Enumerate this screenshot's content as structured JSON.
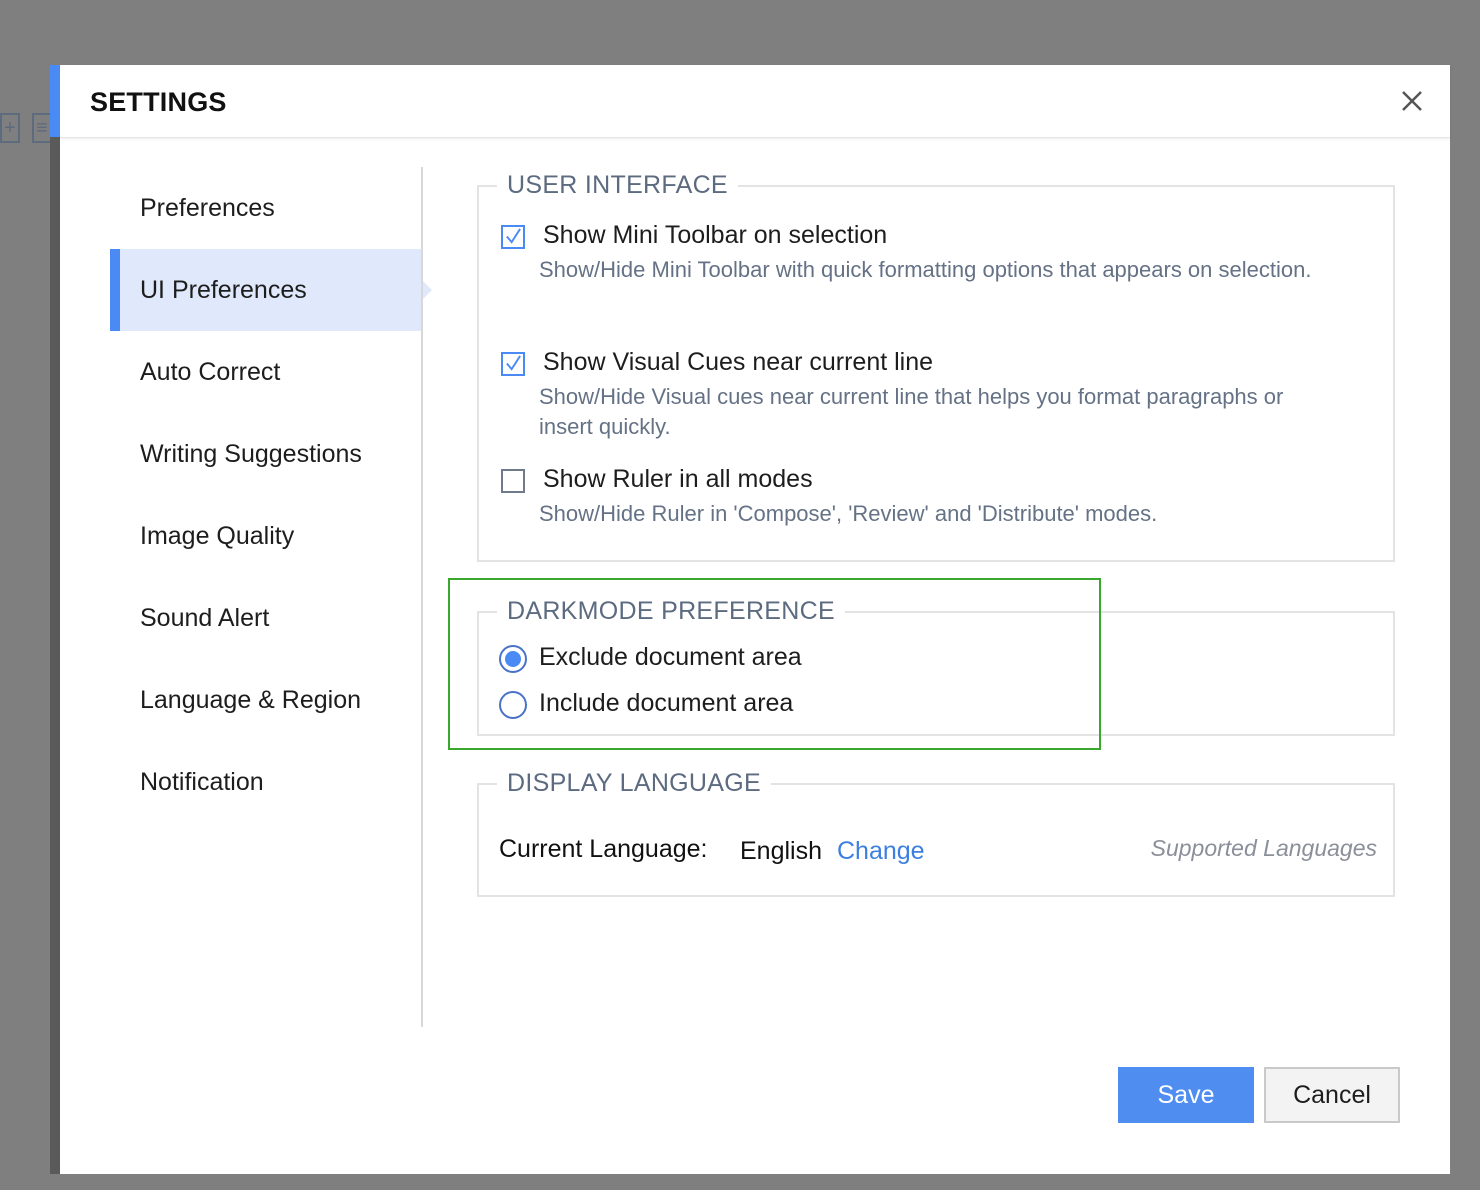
{
  "dialog": {
    "title": "SETTINGS"
  },
  "sidebar": {
    "items": [
      {
        "label": "Preferences",
        "active": false
      },
      {
        "label": "UI Preferences",
        "active": true
      },
      {
        "label": "Auto Correct",
        "active": false
      },
      {
        "label": "Writing Suggestions",
        "active": false
      },
      {
        "label": "Image Quality",
        "active": false
      },
      {
        "label": "Sound Alert",
        "active": false
      },
      {
        "label": "Language & Region",
        "active": false
      },
      {
        "label": "Notification",
        "active": false
      }
    ]
  },
  "user_interface": {
    "title": "USER INTERFACE",
    "options": [
      {
        "label": "Show Mini Toolbar on selection",
        "description": "Show/Hide Mini Toolbar with quick formatting options that appears on selection.",
        "checked": true
      },
      {
        "label": "Show Visual Cues near current line",
        "description": "Show/Hide Visual cues near current line that helps you format paragraphs or insert quickly.",
        "checked": true
      },
      {
        "label": "Show Ruler in all modes",
        "description": "Show/Hide Ruler in 'Compose', 'Review' and 'Distribute' modes.",
        "checked": false
      }
    ]
  },
  "darkmode": {
    "title": "DARKMODE PREFERENCE",
    "options": [
      {
        "label": "Exclude document area",
        "selected": true
      },
      {
        "label": "Include document area",
        "selected": false
      }
    ]
  },
  "display_language": {
    "title": "DISPLAY LANGUAGE",
    "current_label": "Current Language:",
    "current_value": "English",
    "change_link": "Change",
    "supported_link": "Supported Languages"
  },
  "footer": {
    "save_label": "Save",
    "cancel_label": "Cancel"
  },
  "colors": {
    "accent": "#4a8af4",
    "highlight": "#3aa82f",
    "link": "#3c7fe0"
  },
  "icons": {
    "close": "close-icon",
    "check": "check-icon"
  }
}
